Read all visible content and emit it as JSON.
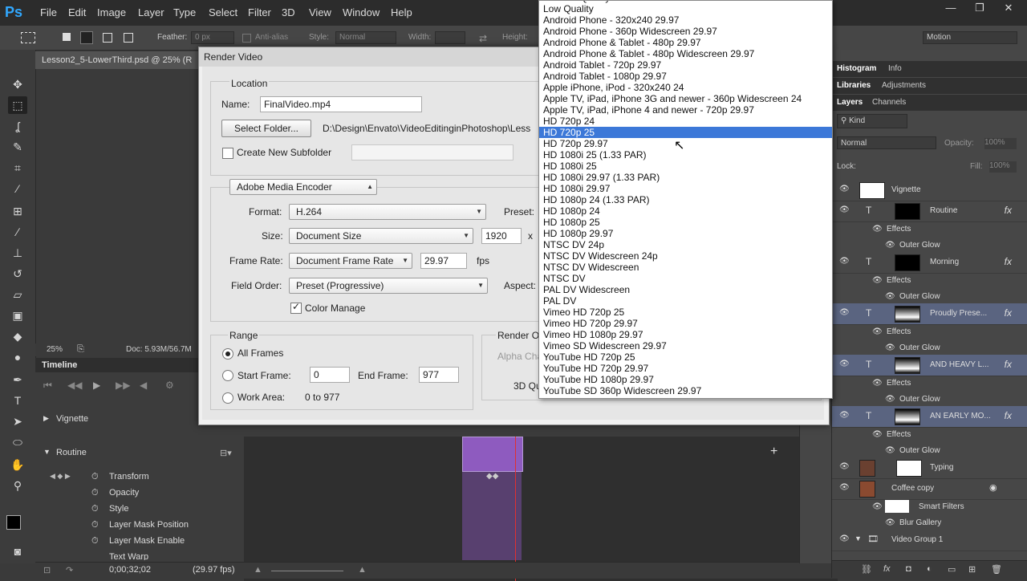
{
  "menubar": {
    "logo": "Ps",
    "items": [
      "File",
      "Edit",
      "Image",
      "Layer",
      "Type",
      "Select",
      "Filter",
      "3D",
      "View",
      "Window",
      "Help"
    ]
  },
  "optbar": {
    "feather_label": "Feather:",
    "feather_value": "0 px",
    "antialias_label": "Anti-alias",
    "style_label": "Style:",
    "style_value": "Normal",
    "width_label": "Width:",
    "height_label": "Height:",
    "workspace": "Motion"
  },
  "document": {
    "tab_title": "Lesson2_5-LowerThird.psd @ 25% (R",
    "zoom": "25%",
    "doc_info": "Doc: 5.93M/56.7M"
  },
  "timeline": {
    "title": "Timeline",
    "tracks": [
      "Vignette",
      "Routine"
    ],
    "properties": [
      "Transform",
      "Opacity",
      "Style",
      "Layer Mask Position",
      "Layer Mask Enable",
      "Text Warp"
    ],
    "timecode": "0;00;32;02",
    "fps": "(29.97 fps)"
  },
  "dialog": {
    "title": "Render Video",
    "location_label": "Location",
    "name_label": "Name:",
    "name_value": "FinalVideo.mp4",
    "select_folder": "Select Folder...",
    "folder_path": "D:\\Design\\Envato\\VideoEditinginPhotoshop\\Less",
    "create_subfolder": "Create New Subfolder",
    "encoder": "Adobe Media Encoder",
    "format_label": "Format:",
    "format_value": "H.264",
    "preset_label": "Preset:",
    "size_label": "Size:",
    "size_value": "Document Size",
    "size_width": "1920",
    "size_x": "x",
    "framerate_label": "Frame Rate:",
    "framerate_value": "Document Frame Rate",
    "framerate_number": "29.97",
    "fps_label": "fps",
    "fieldorder_label": "Field Order:",
    "fieldorder_value": "Preset (Progressive)",
    "aspect_label": "Aspect:",
    "color_manage": "Color Manage",
    "range_label": "Range",
    "all_frames": "All Frames",
    "start_frame_label": "Start Frame:",
    "start_frame_value": "0",
    "end_frame_label": "End Frame:",
    "end_frame_value": "977",
    "work_area_label": "Work Area:",
    "work_area_value": "0 to 977",
    "render_options_label": "Render O",
    "alpha_label": "Alpha Cha",
    "quality_label": "3D Qu"
  },
  "preset_list": {
    "items": [
      "Medium Quality",
      "Low Quality",
      "Android Phone - 320x240 29.97",
      "Android Phone - 360p Widescreen 29.97",
      "Android Phone & Tablet - 480p 29.97",
      "Android Phone & Tablet - 480p Widescreen 29.97",
      "Android Tablet - 720p 29.97",
      "Android Tablet - 1080p 29.97",
      "Apple iPhone, iPod - 320x240 24",
      "Apple TV, iPad, iPhone 3G and newer - 360p Widescreen 24",
      "Apple TV, iPad, iPhone 4 and newer - 720p 29.97",
      "HD 720p 24",
      "HD 720p 25",
      "HD 720p 29.97",
      "HD 1080i 25 (1.33 PAR)",
      "HD 1080i 25",
      "HD 1080i 29.97 (1.33 PAR)",
      "HD 1080i 29.97",
      "HD 1080p 24 (1.33 PAR)",
      "HD 1080p 24",
      "HD 1080p 25",
      "HD 1080p 29.97",
      "NTSC DV 24p",
      "NTSC DV Widescreen 24p",
      "NTSC DV Widescreen",
      "NTSC DV",
      "PAL DV Widescreen",
      "PAL DV",
      "Vimeo HD 720p 25",
      "Vimeo HD 720p 29.97",
      "Vimeo HD 1080p 29.97",
      "Vimeo SD Widescreen 29.97",
      "YouTube HD 720p 25",
      "YouTube HD 720p 29.97",
      "YouTube HD 1080p 29.97",
      "YouTube SD 360p Widescreen 29.97"
    ],
    "highlighted": "HD 720p 25"
  },
  "panels": {
    "tabs1": [
      "Histogram",
      "Info"
    ],
    "tabs2": [
      "Libraries",
      "Adjustments"
    ],
    "tabs3": [
      "Layers",
      "Channels"
    ],
    "kind_label": "Kind",
    "blend_mode": "Normal",
    "opacity_label": "Opacity:",
    "opacity_value": "100%",
    "lock_label": "Lock:",
    "fill_label": "Fill:",
    "fill_value": "100%",
    "layers": [
      {
        "name": "Vignette"
      },
      {
        "name": "Routine"
      },
      {
        "name": "Morning"
      },
      {
        "name": "Proudly Prese..."
      },
      {
        "name": "AND HEAVY L..."
      },
      {
        "name": "AN EARLY MO..."
      },
      {
        "name": "Typing"
      },
      {
        "name": "Coffee copy"
      },
      {
        "name": "Video Group 1"
      }
    ],
    "effects_label": "Effects",
    "outer_glow_label": "Outer Glow",
    "smart_filters_label": "Smart Filters",
    "blur_gallery_label": "Blur Gallery",
    "fx_label": "fx",
    "type_glyph": "T"
  }
}
